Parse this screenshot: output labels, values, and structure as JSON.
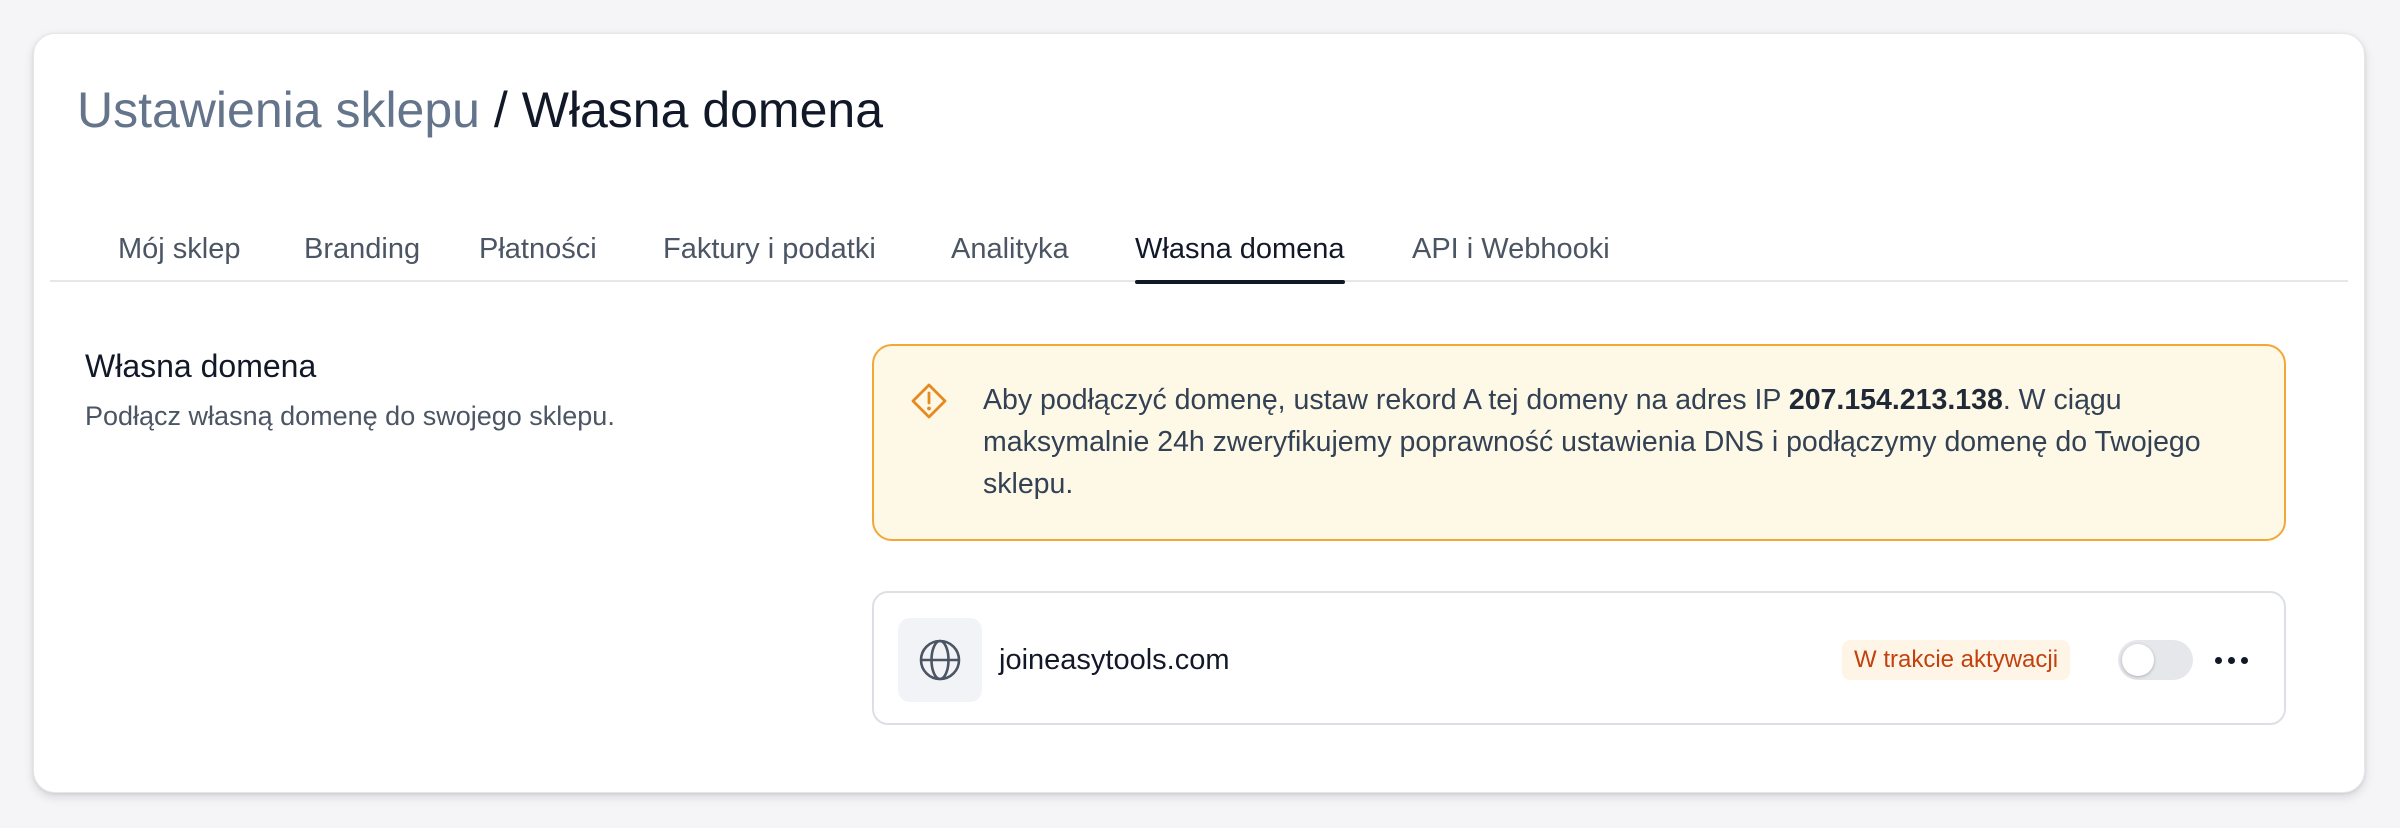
{
  "header": {
    "breadcrumb_parent": "Ustawienia sklepu",
    "separator": "/",
    "current": "Własna domena"
  },
  "tabs": [
    {
      "label": "Mój sklep",
      "active": false
    },
    {
      "label": "Branding",
      "active": false
    },
    {
      "label": "Płatności",
      "active": false
    },
    {
      "label": "Faktury i podatki",
      "active": false
    },
    {
      "label": "Analityka",
      "active": false
    },
    {
      "label": "Własna domena",
      "active": true
    },
    {
      "label": "API i Webhooki",
      "active": false
    }
  ],
  "section": {
    "title": "Własna domena",
    "description": "Podłącz własną domenę do swojego sklepu."
  },
  "alert": {
    "icon": "warning-diamond-icon",
    "text_before": "Aby podłączyć domenę, ustaw rekord A tej domeny na adres IP ",
    "ip": "207.154.213.138",
    "text_after": ". W ciągu maksymalnie 24h zweryfikujemy poprawność ustawienia DNS i podłączymy domenę do Twojego sklepu.",
    "border_color": "#f3a736",
    "background": "#fef9e6"
  },
  "domain_row": {
    "icon": "globe-icon",
    "name": "joineasytools.com",
    "status": "W trakcie aktywacji",
    "status_color": "#c2410c",
    "enabled": false,
    "menu_icon": "more-horizontal-icon"
  }
}
